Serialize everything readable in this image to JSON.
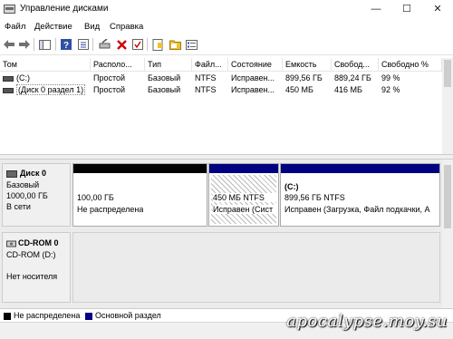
{
  "window": {
    "title": "Управление дисками",
    "controls": {
      "minimize": "—",
      "maximize": "☐",
      "close": "✕"
    }
  },
  "menu": [
    "Файл",
    "Действие",
    "Вид",
    "Справка"
  ],
  "toolbar": {
    "icons": [
      "back-icon",
      "forward-icon",
      "console-tree-icon",
      "help-icon",
      "properties-icon",
      "connect-icon",
      "delete-icon",
      "check-icon",
      "folder-icon",
      "open-folder-icon",
      "list-view-icon"
    ]
  },
  "volume_list": {
    "columns": [
      "Том",
      "Располо...",
      "Тип",
      "Файл...",
      "Состояние",
      "Емкость",
      "Свобод...",
      "Свободно %"
    ],
    "rows": [
      {
        "name": "(C:)",
        "layout": "Простой",
        "type": "Базовый",
        "fs": "NTFS",
        "status": "Исправен...",
        "capacity": "899,56 ГБ",
        "free": "889,24 ГБ",
        "free_pct": "99 %"
      },
      {
        "name": "(Диск 0 раздел 1)",
        "layout": "Простой",
        "type": "Базовый",
        "fs": "NTFS",
        "status": "Исправен...",
        "capacity": "450 МБ",
        "free": "416 МБ",
        "free_pct": "92 %"
      }
    ]
  },
  "disks": [
    {
      "name": "Диск 0",
      "type": "Базовый",
      "size": "1000,00 ГБ",
      "state": "В сети",
      "partitions": [
        {
          "size": "100,00 ГБ",
          "status": "Не распределена",
          "bar_color": "#000000",
          "hatched": false
        },
        {
          "size": "450 МБ NTFS",
          "status": "Исправен (Сист",
          "bar_color": "#000080",
          "hatched": true
        },
        {
          "label": "(C:)",
          "size": "899,56 ГБ NTFS",
          "status": "Исправен (Загрузка, Файл подкачки, А",
          "bar_color": "#000080",
          "hatched": false
        }
      ]
    },
    {
      "name": "CD-ROM 0",
      "type": "CD-ROM (D:)",
      "state": "Нет носителя"
    }
  ],
  "legend": [
    {
      "label": "Не распределена",
      "color": "#000000"
    },
    {
      "label": "Основной раздел",
      "color": "#000080"
    }
  ],
  "watermark": "apocalypse.moy.su"
}
